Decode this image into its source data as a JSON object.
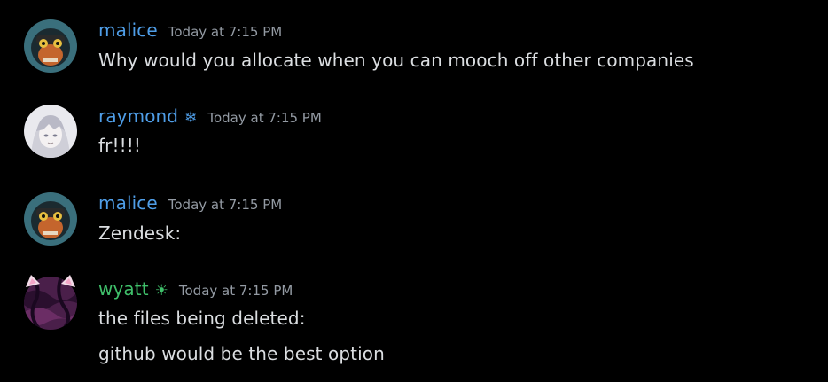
{
  "messages": [
    {
      "username": "malice",
      "username_color": "#4f9ee8",
      "badge": "",
      "timestamp": "Today at 7:15 PM",
      "lines": [
        "Why would you allocate when you can mooch off other companies"
      ]
    },
    {
      "username": "raymond",
      "username_color": "#4f9ee8",
      "badge": "❄",
      "badge_icon": "snowflake-icon",
      "timestamp": "Today at 7:15 PM",
      "lines": [
        "fr!!!!"
      ]
    },
    {
      "username": "malice",
      "username_color": "#4f9ee8",
      "badge": "",
      "timestamp": "Today at 7:15 PM",
      "lines": [
        "Zendesk:"
      ]
    },
    {
      "username": "wyatt",
      "username_color": "#3fbf6a",
      "badge": "☀",
      "badge_icon": "sun-icon",
      "timestamp": "Today at 7:15 PM",
      "lines": [
        "the files being deleted:",
        "github would be the best option"
      ]
    }
  ]
}
